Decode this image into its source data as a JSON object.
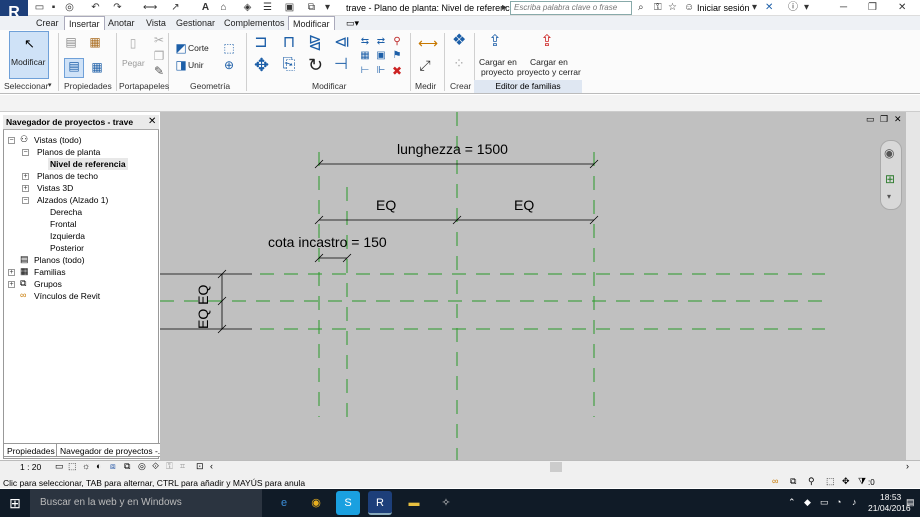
{
  "app": {
    "logo": "R",
    "doc_title": "trave - Plano de planta: Nivel de referencia",
    "search_placeholder": "Escriba palabra clave o frase",
    "login": "Iniciar sesión"
  },
  "tabs": [
    "Crear",
    "Insertar",
    "Anotar",
    "Vista",
    "Gestionar",
    "Complementos",
    "Modificar"
  ],
  "active_tab": "Modificar",
  "ribbon": {
    "modify_label": "Modificar",
    "corte_label": "Corte",
    "unir_label": "Unir",
    "pegar_label": "Pegar",
    "cargar_proyecto": [
      "Cargar en",
      "proyecto"
    ],
    "cargar_cerrar": [
      "Cargar en",
      "proyecto y cerrar"
    ],
    "panels": [
      "Seleccionar",
      "Propiedades",
      "Portapapeles",
      "Geometría",
      "Modificar",
      "Medir",
      "Crear",
      "Editor de familias"
    ]
  },
  "browser": {
    "title": "Navegador de proyectos - trave",
    "items": [
      {
        "label": "Vistas (todo)"
      },
      {
        "label": "Planos de planta"
      },
      {
        "label": "Nivel de referencia"
      },
      {
        "label": "Planos de techo"
      },
      {
        "label": "Vistas 3D"
      },
      {
        "label": "Alzados (Alzado 1)"
      },
      {
        "label": "Derecha"
      },
      {
        "label": "Frontal"
      },
      {
        "label": "Izquierda"
      },
      {
        "label": "Posterior"
      },
      {
        "label": "Planos (todo)"
      },
      {
        "label": "Familias"
      },
      {
        "label": "Grupos"
      },
      {
        "label": "Vínculos de Revit"
      }
    ],
    "bottom_tabs": [
      "Propiedades",
      "Navegador de proyectos -..."
    ]
  },
  "drawing": {
    "dim_total": "lunghezza = 1500",
    "dim_eq_left": "EQ",
    "dim_eq_right": "EQ",
    "dim_incastro": "cota incastro = 150",
    "dim_vertical": "EQ EQ"
  },
  "status": {
    "scale": "1 : 20",
    "message": "Clic para seleccionar, TAB para alternar, CTRL para añadir y MAYÚS para anula",
    "filter_count": ":0"
  },
  "taskbar": {
    "search": "Buscar en la web y en Windows",
    "time": "18:53",
    "date": "21/04/2016"
  }
}
